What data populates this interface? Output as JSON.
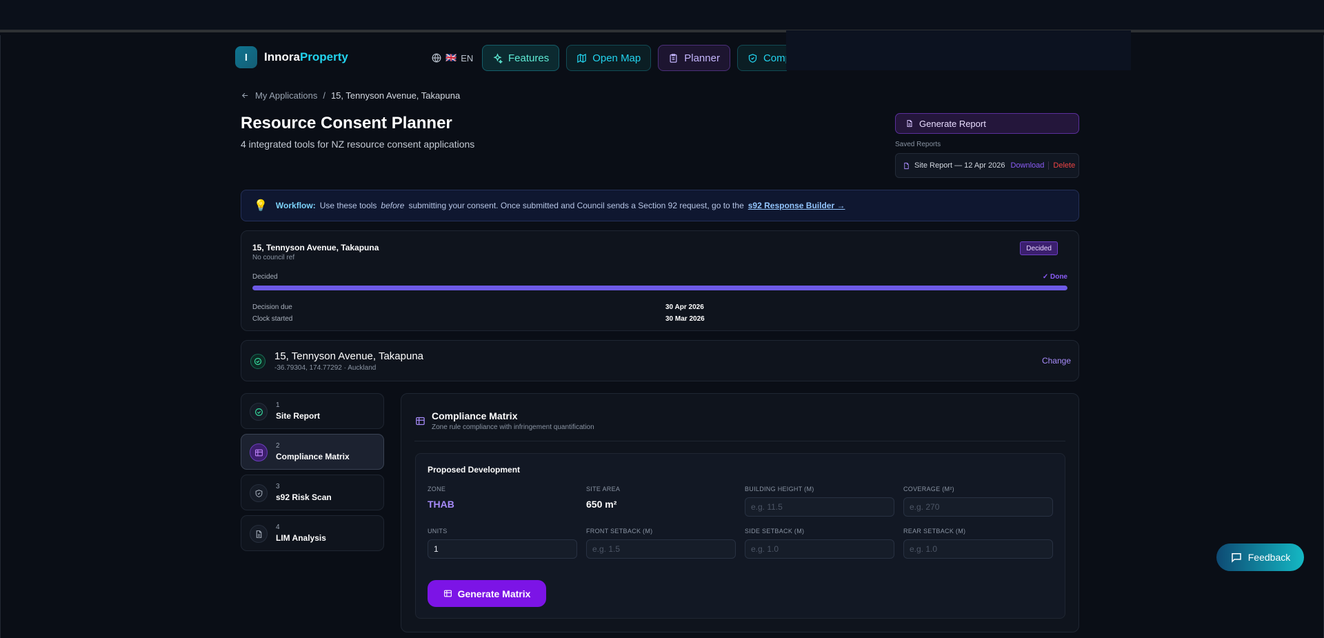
{
  "brand": {
    "badge": "I",
    "name": "Innora",
    "accent": "Property"
  },
  "lang": {
    "flag": "🇬🇧",
    "code": "EN"
  },
  "nav": [
    {
      "label": "Features",
      "icon": "sparkle-icon"
    },
    {
      "label": "Open Map",
      "icon": "map-icon"
    },
    {
      "label": "Planner",
      "icon": "clipboard-icon"
    },
    {
      "label": "Compliance",
      "icon": "shield-icon"
    }
  ],
  "breadcrumb": {
    "back": "My Applications",
    "sep": "/",
    "current": "15, Tennyson Avenue, Takapuna"
  },
  "page": {
    "title": "Resource Consent Planner",
    "subtitle": "4 integrated tools for NZ resource consent applications"
  },
  "reports": {
    "generate_label": "Generate Report",
    "saved_label": "Saved Reports",
    "saved": [
      {
        "name": "Site Report — 12 Apr 2026",
        "download": "Download",
        "delete": "Delete"
      }
    ]
  },
  "workflow": {
    "label": "Workflow:",
    "text1": "Use these tools",
    "em": "before",
    "text2": "submitting your consent. Once submitted and Council sends a Section 92 request, go to the",
    "link": "s92 Response Builder →"
  },
  "status": {
    "address": "15, Tennyson Avenue, Takapuna",
    "ref": "No council ref",
    "badge": "Decided",
    "stage": "Decided",
    "done": "✓ Done",
    "progress": 1.0,
    "decision_due_label": "Decision due",
    "decision_due": "30 Apr 2026",
    "clock_label": "Clock started",
    "clock": "30 Mar 2026"
  },
  "address": {
    "title": "15, Tennyson Avenue, Takapuna",
    "sub": "-36.79304, 174.77292 · Auckland",
    "change": "Change"
  },
  "steps": [
    {
      "num": "1",
      "label": "Site Report",
      "icon": "check-circle-icon"
    },
    {
      "num": "2",
      "label": "Compliance Matrix",
      "icon": "table-icon"
    },
    {
      "num": "3",
      "label": "s92 Risk Scan",
      "icon": "shield-icon"
    },
    {
      "num": "4",
      "label": "LIM Analysis",
      "icon": "document-icon"
    }
  ],
  "matrix": {
    "title": "Compliance Matrix",
    "subtitle": "Zone rule compliance with infringement quantification",
    "section": "Proposed Development",
    "zone_label": "ZONE",
    "zone": "THAB",
    "site_area_label": "SITE AREA",
    "site_area": "650 m²",
    "height_label": "BUILDING HEIGHT (M)",
    "height_ph": "e.g. 11.5",
    "coverage_label": "COVERAGE (M²)",
    "coverage_ph": "e.g. 270",
    "units_label": "UNITS",
    "units": "1",
    "front_label": "FRONT SETBACK (M)",
    "front_ph": "e.g. 1.5",
    "side_label": "SIDE SETBACK (M)",
    "side_ph": "e.g. 1.0",
    "rear_label": "REAR SETBACK (M)",
    "rear_ph": "e.g. 1.0",
    "button": "Generate Matrix"
  },
  "feedback": "Feedback",
  "colors": {
    "accent_purple": "#7c14e6",
    "accent_teal": "#22d3ee",
    "zone": "#a78bfa"
  }
}
